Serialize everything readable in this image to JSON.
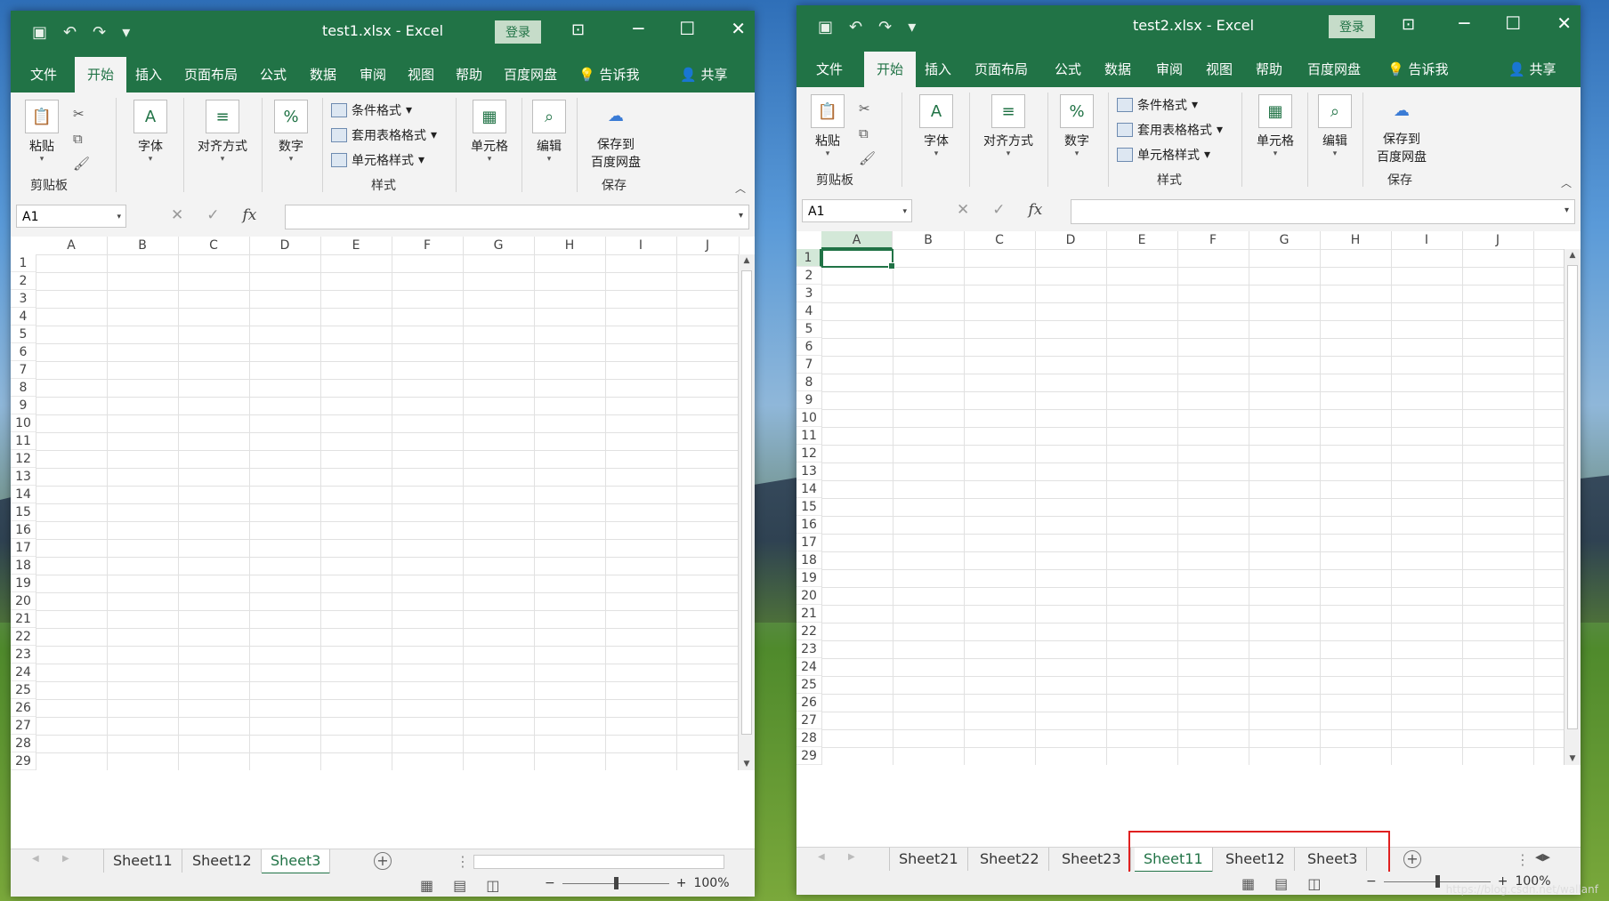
{
  "windows": [
    {
      "title": "test1.xlsx  -  Excel",
      "login": "登录",
      "menu": {
        "file": "文件",
        "home": "开始",
        "insert": "插入",
        "layout": "页面布局",
        "formulas": "公式",
        "data": "数据",
        "review": "审阅",
        "view": "视图",
        "help": "帮助",
        "baidu": "百度网盘",
        "tellme": "告诉我",
        "share": "共享"
      },
      "ribbon": {
        "paste": "粘贴",
        "font": "字体",
        "align": "对齐方式",
        "number": "数字",
        "cond_fmt": "条件格式",
        "table_fmt": "套用表格格式",
        "cell_style": "单元格样式",
        "cells": "单元格",
        "edit": "编辑",
        "save_to": "保存到",
        "baidu_pan": "百度网盘",
        "clipboard": "剪贴板",
        "styles": "样式",
        "save": "保存"
      },
      "name_box": "A1",
      "columns": [
        "A",
        "B",
        "C",
        "D",
        "E",
        "F",
        "G",
        "H",
        "I",
        "J"
      ],
      "rows": [
        "1",
        "2",
        "3",
        "4",
        "5",
        "6",
        "7",
        "8",
        "9",
        "10",
        "11",
        "12",
        "13",
        "14",
        "15",
        "16",
        "17",
        "18",
        "19",
        "20",
        "21",
        "22",
        "23",
        "24",
        "25",
        "26",
        "27",
        "28",
        "29"
      ],
      "sheets": [
        "Sheet11",
        "Sheet12",
        "Sheet3"
      ],
      "active_sheet": "Sheet3",
      "zoom": "100%"
    },
    {
      "title": "test2.xlsx  -  Excel",
      "login": "登录",
      "menu": {
        "file": "文件",
        "home": "开始",
        "insert": "插入",
        "layout": "页面布局",
        "formulas": "公式",
        "data": "数据",
        "review": "审阅",
        "view": "视图",
        "help": "帮助",
        "baidu": "百度网盘",
        "tellme": "告诉我",
        "share": "共享"
      },
      "ribbon": {
        "paste": "粘贴",
        "font": "字体",
        "align": "对齐方式",
        "number": "数字",
        "cond_fmt": "条件格式",
        "table_fmt": "套用表格格式",
        "cell_style": "单元格样式",
        "cells": "单元格",
        "edit": "编辑",
        "save_to": "保存到",
        "baidu_pan": "百度网盘",
        "clipboard": "剪贴板",
        "styles": "样式",
        "save": "保存"
      },
      "name_box": "A1",
      "columns": [
        "A",
        "B",
        "C",
        "D",
        "E",
        "F",
        "G",
        "H",
        "I",
        "J"
      ],
      "rows": [
        "1",
        "2",
        "3",
        "4",
        "5",
        "6",
        "7",
        "8",
        "9",
        "10",
        "11",
        "12",
        "13",
        "14",
        "15",
        "16",
        "17",
        "18",
        "19",
        "20",
        "21",
        "22",
        "23",
        "24",
        "25",
        "26",
        "27",
        "28",
        "29"
      ],
      "sheets": [
        "Sheet21",
        "Sheet22",
        "Sheet23",
        "Sheet11",
        "Sheet12",
        "Sheet3"
      ],
      "active_sheet": "Sheet11",
      "zoom": "100%"
    }
  ],
  "watermark": "https://blog.csdn.net/wallanf",
  "colors": {
    "excel_green": "#217346",
    "highlight": "#e02020"
  }
}
